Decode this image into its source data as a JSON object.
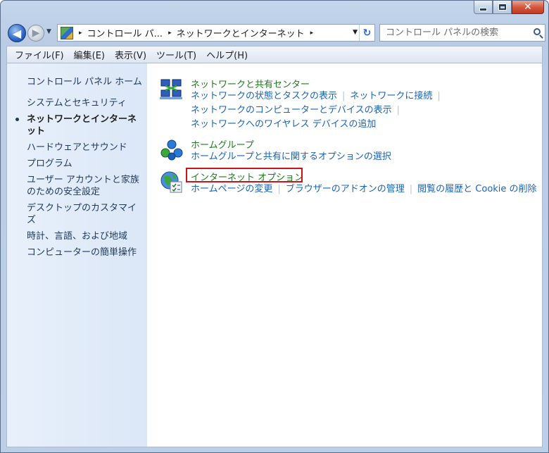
{
  "window": {
    "caption": {
      "minimize": "—",
      "maximize": "□",
      "close": "✕"
    }
  },
  "nav": {
    "back_glyph": "◀",
    "forward_glyph": "▶",
    "recent_glyph": "▼",
    "breadcrumbs": [
      "コントロール パ...",
      "ネットワークとインターネット"
    ],
    "sep": "▸",
    "dropdown_glyph": "▼",
    "refresh_glyph": "↻",
    "search_placeholder": "コントロール パネルの検索"
  },
  "menu": [
    "ファイル(F)",
    "編集(E)",
    "表示(V)",
    "ツール(T)",
    "ヘルプ(H)"
  ],
  "sidebar": {
    "home": "コントロール パネル ホーム",
    "items": [
      "システムとセキュリティ",
      "ネットワークとインターネット",
      "ハードウェアとサウンド",
      "プログラム",
      "ユーザー アカウントと家族のための安全設定",
      "デスクトップのカスタマイズ",
      "時計、言語、および地域",
      "コンピューターの簡単操作"
    ],
    "current_index": 1
  },
  "categories": {
    "network_center": {
      "title": "ネットワークと共有センター",
      "links": [
        "ネットワークの状態とタスクの表示",
        "ネットワークに接続",
        "ネットワークのコンピューターとデバイスの表示",
        "ネットワークへのワイヤレス デバイスの追加"
      ]
    },
    "homegroup": {
      "title": "ホームグループ",
      "links": [
        "ホームグループと共有に関するオプションの選択"
      ]
    },
    "internet_options": {
      "title": "インターネット オプション",
      "links": [
        "ホームページの変更",
        "ブラウザーのアドオンの管理",
        "閲覧の履歴と Cookie の削除"
      ]
    }
  },
  "colors": {
    "link": "#1a63b8",
    "category_title": "#1e7a1e",
    "highlight": "#c8141b"
  }
}
